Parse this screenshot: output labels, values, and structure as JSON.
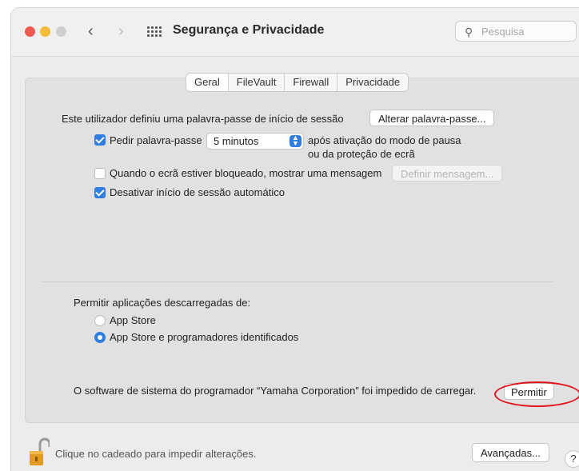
{
  "window": {
    "title": "Segurança e Privacidade"
  },
  "toolbar": {
    "back": "‹",
    "forward": "›",
    "search_placeholder": "Pesquisa"
  },
  "tabs": [
    "Geral",
    "FileVault",
    "Firewall",
    "Privacidade"
  ],
  "general": {
    "password_set_text": "Este utilizador definiu uma palavra-passe de início de sessão",
    "change_password_button": "Alterar palavra-passe...",
    "require_password_label": "Pedir palavra-passe",
    "require_password_checked": true,
    "require_password_delay": "5 minutos",
    "after_sleep_line1": "após ativação do modo de pausa",
    "after_sleep_line2": "ou da proteção de ecrã",
    "show_message_label": "Quando o ecrã estiver bloqueado, mostrar uma mensagem",
    "show_message_checked": false,
    "set_message_button": "Definir mensagem...",
    "disable_autologin_label": "Desativar início de sessão automático",
    "disable_autologin_checked": true
  },
  "apps": {
    "heading": "Permitir aplicações descarregadas de:",
    "option_app_store": "App Store",
    "option_identified": "App Store e programadores identificados",
    "selected": "App Store e programadores identificados"
  },
  "blocked": {
    "message": "O software de sistema do programador “Yamaha Corporation” foi impedido de carregar.",
    "allow_button": "Permitir"
  },
  "footer": {
    "lock_text": "Clique no cadeado para impedir alterações.",
    "advanced_button": "Avançadas...",
    "help_button": "?"
  },
  "colors": {
    "accent": "#2f7de1",
    "annotation": "#e2141d"
  }
}
